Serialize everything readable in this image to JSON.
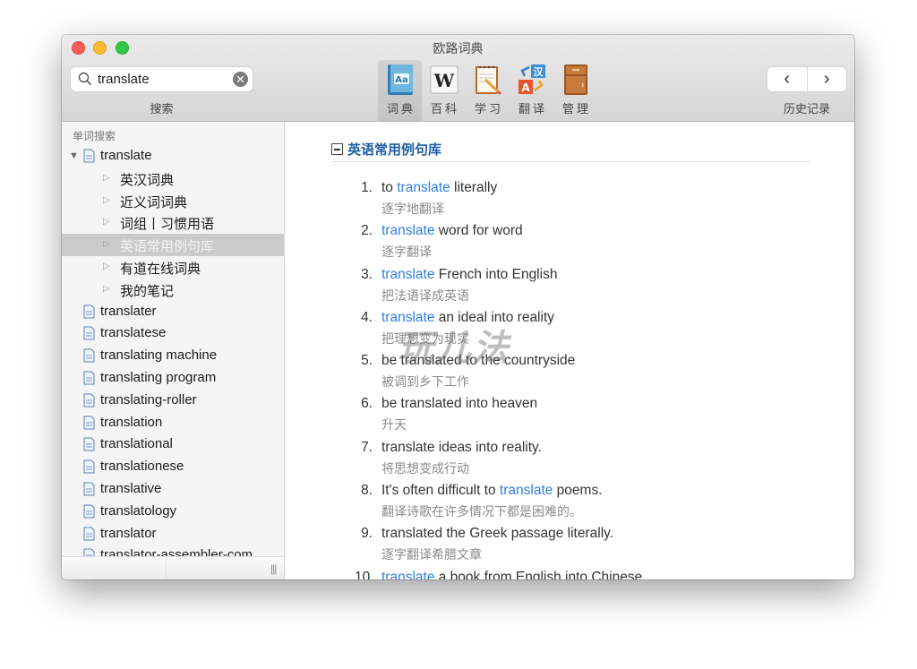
{
  "window": {
    "title": "欧路词典"
  },
  "search": {
    "value": "translate",
    "placeholder": "",
    "label": "搜索"
  },
  "toolbar": {
    "items": [
      {
        "label": "词典",
        "icon": "dictionary-book-icon",
        "active": true
      },
      {
        "label": "百科",
        "icon": "wikipedia-icon",
        "active": false
      },
      {
        "label": "学习",
        "icon": "notepad-pencil-icon",
        "active": false
      },
      {
        "label": "翻译",
        "icon": "translate-icon",
        "active": false
      },
      {
        "label": "管理",
        "icon": "cabinet-icon",
        "active": false
      }
    ]
  },
  "history": {
    "back": "‹",
    "forward": "›",
    "label": "历史记录"
  },
  "sidebar": {
    "section_label": "单词搜索",
    "root": "translate",
    "children": [
      "英汉词典",
      "近义词词典",
      "词组丨习惯用语",
      "英语常用例句库",
      "有道在线词典",
      "我的笔记"
    ],
    "selected_child": 3,
    "words": [
      "translater",
      "translatese",
      "translating machine",
      "translating program",
      "translating-roller",
      "translation",
      "translational",
      "translationese",
      "translative",
      "translatology",
      "translator",
      "translator-assembler-com"
    ],
    "grip": "|||"
  },
  "content": {
    "section_title": "英语常用例句库",
    "watermark": "玩儿法",
    "examples": [
      {
        "num": "1.",
        "pre": "to ",
        "hl": "translate",
        "post": " literally",
        "zh": "逐字地翻译"
      },
      {
        "num": "2.",
        "pre": "",
        "hl": "translate",
        "post": " word for word",
        "zh": "逐字翻译"
      },
      {
        "num": "3.",
        "pre": "",
        "hl": "translate",
        "post": " French into English",
        "zh": "把法语译成英语"
      },
      {
        "num": "4.",
        "pre": "",
        "hl": "translate",
        "post": " an ideal into reality",
        "zh": "把理想变为现实"
      },
      {
        "num": "5.",
        "pre": "be translated to the countryside",
        "hl": "",
        "post": "",
        "zh": "被调到乡下工作"
      },
      {
        "num": "6.",
        "pre": "be translated into heaven",
        "hl": "",
        "post": "",
        "zh": "升天"
      },
      {
        "num": "7.",
        "pre": "translate ideas into reality.",
        "hl": "",
        "post": "",
        "zh": "将思想变成行动"
      },
      {
        "num": "8.",
        "pre": "It's often difficult to ",
        "hl": "translate",
        "post": " poems.",
        "zh": "翻译诗歌在许多情况下都是困难的。"
      },
      {
        "num": "9.",
        "pre": "translated the Greek passage literally.",
        "hl": "",
        "post": "",
        "zh": "逐字翻译希腊文章"
      },
      {
        "num": "10.",
        "pre": "",
        "hl": "translate",
        "post": " a book from English into Chinese",
        "zh": ""
      }
    ]
  }
}
